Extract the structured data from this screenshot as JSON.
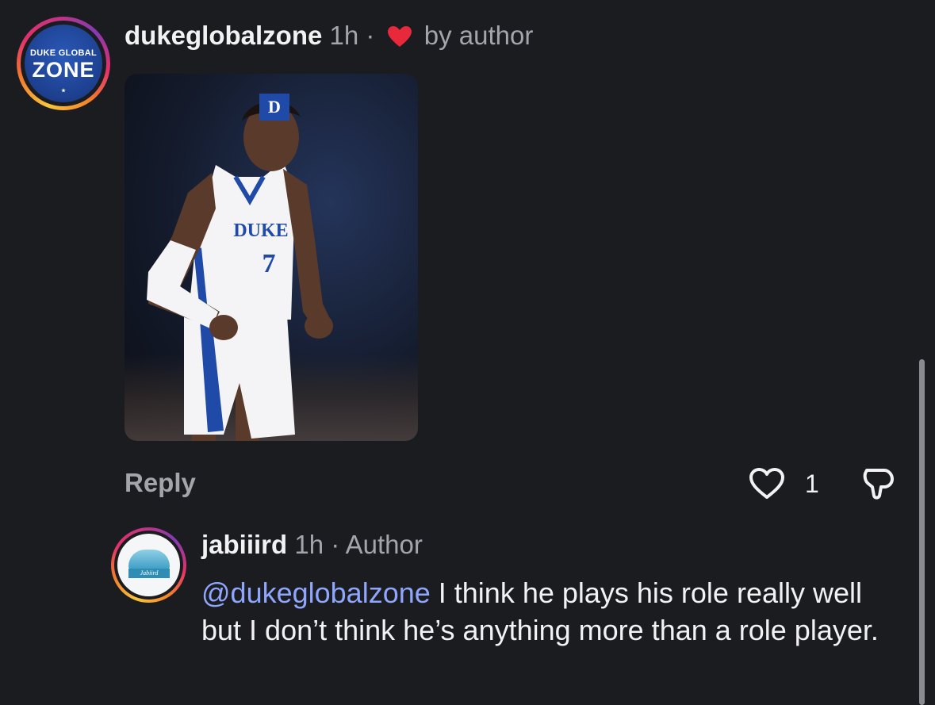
{
  "comment": {
    "avatar": {
      "line1": "DUKE GLOBAL",
      "line2": "ZONE",
      "icon": "duke-global-zone-logo"
    },
    "username": "dukeglobalzone",
    "time": "1h",
    "separator": "·",
    "liked_by_author": "by author",
    "heart_color": "#e8293b",
    "media": {
      "badge": "D",
      "description_icon": "basketball-player-photo"
    },
    "reply_label": "Reply",
    "like_count": "1"
  },
  "reply": {
    "avatar": {
      "label": "Jabiird",
      "icon": "wave-logo"
    },
    "username": "jabiiird",
    "time": "1h",
    "separator": "·",
    "badge": "Author",
    "mention": "@dukeglobalzone",
    "text": " I think he plays his role really well but I don’t think he’s anything more than a role player."
  },
  "colors": {
    "background": "#1b1c20",
    "mention": "#8fa6ff",
    "muted": "#a3a5ab"
  }
}
